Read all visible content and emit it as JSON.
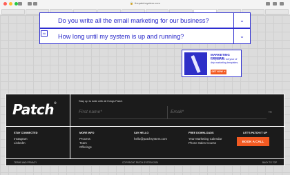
{
  "browser": {
    "url": "thepatchsystem.com",
    "traffic_colors": [
      "#ff5f57",
      "#febc2e",
      "#28c840"
    ]
  },
  "faq": [
    {
      "question": "Do you write all the email marketing for our business?"
    },
    {
      "question": "How long until my system is up and running?"
    }
  ],
  "faq_toggle": "⌄",
  "side_mark": "##",
  "promo": {
    "title": "MARKETING FREEBIE",
    "description": "Get your one full year of drip marketing templates.",
    "button": "GET NOW ↗"
  },
  "footer": {
    "logo": "Patch",
    "newsletter_label": "Stay up to date with all things Patch",
    "first_name_placeholder": "First name*",
    "email_placeholder": "Email*",
    "submit_icon": "→",
    "stay_connected": {
      "heading": "STAY CONNECTED",
      "items": [
        "Instagram",
        "LinkedIn"
      ]
    },
    "more_info": {
      "heading": "MORE INFO",
      "items": [
        "Process",
        "Team",
        "Offerings"
      ]
    },
    "say_hello": {
      "heading": "SAY HELLO",
      "items": [
        "hello@patchsystem.com"
      ]
    },
    "free_downloads": {
      "heading": "FREE DOWNLOADS",
      "items": [
        "Year Marketing Calendar",
        "Phone Sales Course"
      ]
    },
    "lets_patch": {
      "heading": "LET'S PATCH IT UP",
      "button": "BOOK A CALL"
    },
    "bottom": {
      "terms": "TERMS AND PRIVACY",
      "copyright": "COPYRIGHT PATCH SYSTEM 2024",
      "back_to_top": "BACK TO TOP"
    }
  },
  "colors": {
    "accent": "#2626c9",
    "orange": "#f25a22",
    "footer_bg": "#1b1b1b"
  }
}
